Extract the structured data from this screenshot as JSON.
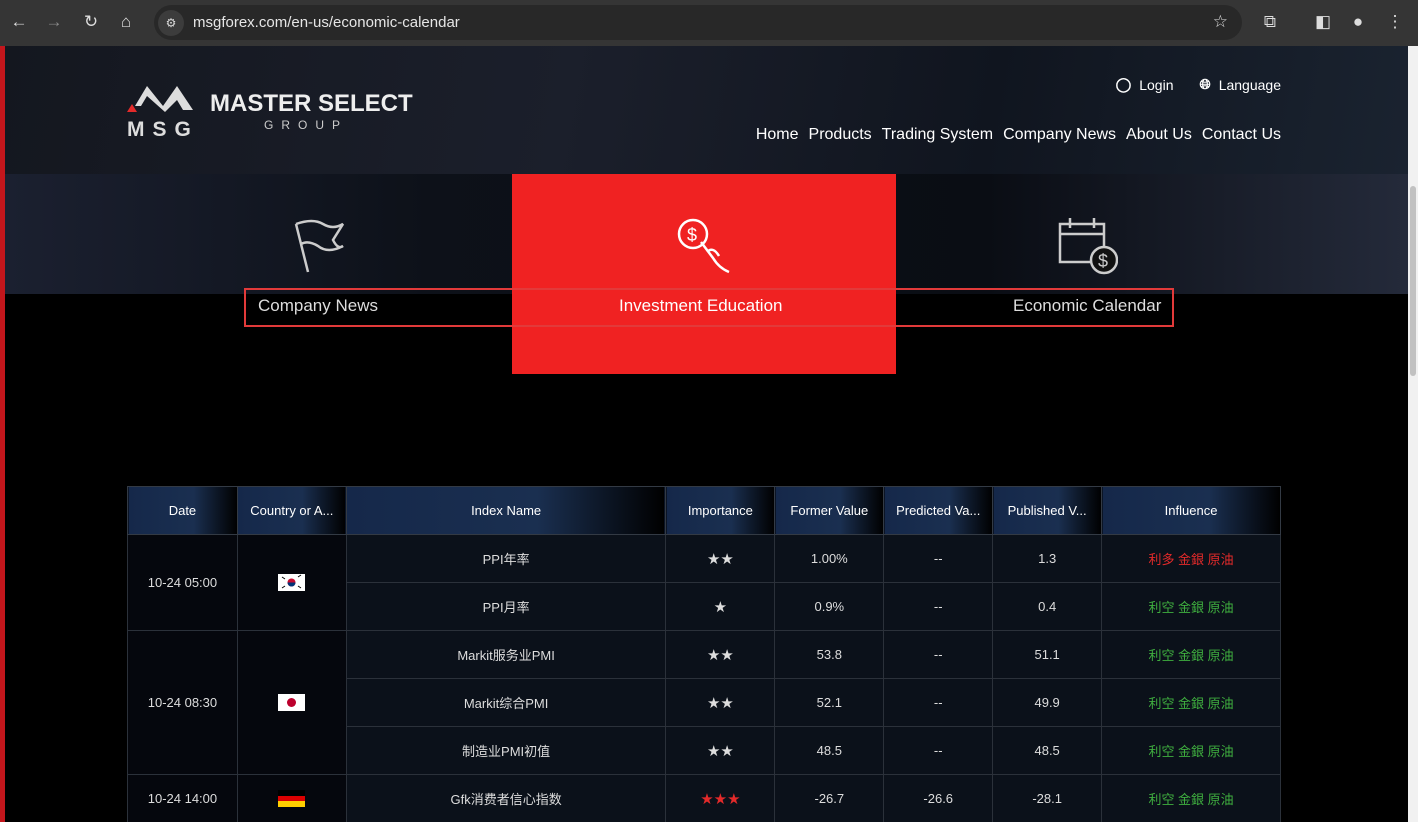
{
  "browser": {
    "url": "msgforex.com/en-us/economic-calendar"
  },
  "logo": {
    "mark": "MSG",
    "name": "MASTER SELECT",
    "sub": "GROUP"
  },
  "header": {
    "login": "Login",
    "language": "Language",
    "nav": [
      "Home",
      "Products",
      "Trading System",
      "Company News",
      "About Us",
      "Contact Us"
    ]
  },
  "tabs": [
    {
      "label": "Company News",
      "icon": "flag-icon"
    },
    {
      "label": "Investment Education",
      "icon": "dollar-hand-icon",
      "active": true
    },
    {
      "label": "Economic Calendar",
      "icon": "calendar-dollar-icon"
    }
  ],
  "colors": {
    "accent": "#f02222",
    "bullish": "#e32a2a",
    "bearish": "#3fae3f"
  },
  "table": {
    "headers": [
      "Date",
      "Country or A...",
      "Index Name",
      "Importance",
      "Former Value",
      "Predicted Va...",
      "Published V...",
      "Influence"
    ],
    "groups": [
      {
        "date": "10-24 05:00",
        "country": "South Korea",
        "rows": [
          {
            "name": "PPI年率",
            "stars": "★★",
            "former": "1.00%",
            "predicted": "--",
            "published": "1.3",
            "influence": "利多 金銀 原油",
            "bull": true
          },
          {
            "name": "PPI月率",
            "stars": "★",
            "former": "0.9%",
            "predicted": "--",
            "published": "0.4",
            "influence": "利空 金銀 原油"
          }
        ]
      },
      {
        "date": "10-24 08:30",
        "country": "Japan",
        "rows": [
          {
            "name": "Markit服务业PMI",
            "stars": "★★",
            "former": "53.8",
            "predicted": "--",
            "published": "51.1",
            "influence": "利空 金銀 原油"
          },
          {
            "name": "Markit综合PMI",
            "stars": "★★",
            "former": "52.1",
            "predicted": "--",
            "published": "49.9",
            "influence": "利空 金銀 原油"
          },
          {
            "name": "制造业PMI初值",
            "stars": "★★",
            "former": "48.5",
            "predicted": "--",
            "published": "48.5",
            "influence": "利空 金銀 原油"
          }
        ]
      },
      {
        "date": "10-24 14:00",
        "country": "Germany",
        "rows": [
          {
            "name": "Gfk消费者信心指数",
            "stars": "★★★",
            "former": "-26.7",
            "predicted": "-26.6",
            "published": "-28.1",
            "influence": "利空 金銀 原油",
            "red_stars": true
          }
        ]
      }
    ]
  }
}
